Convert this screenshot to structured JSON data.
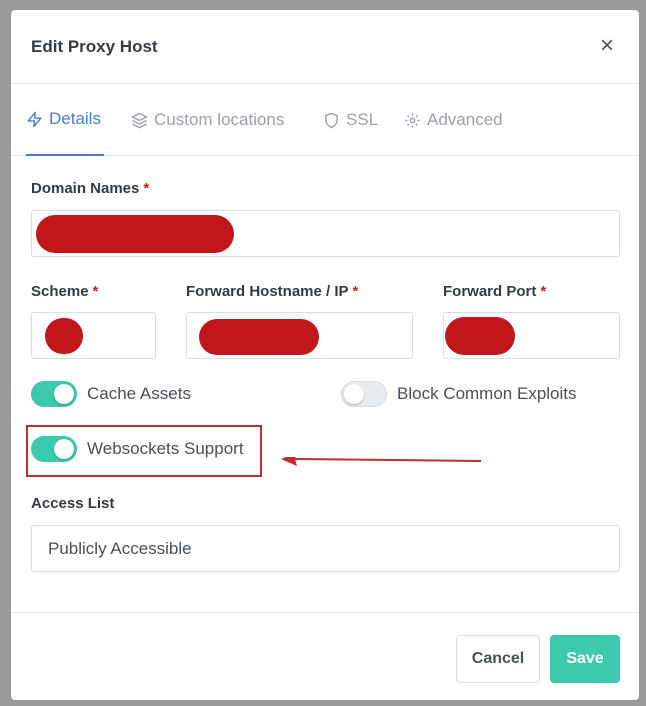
{
  "modal": {
    "title": "Edit Proxy Host",
    "close_symbol": "×"
  },
  "tabs": [
    {
      "label": "Details",
      "icon": "lightning-icon",
      "active": true
    },
    {
      "label": "Custom locations",
      "icon": "layers-icon",
      "active": false
    },
    {
      "label": "SSL",
      "icon": "shield-icon",
      "active": false
    },
    {
      "label": "Advanced",
      "icon": "gear-icon",
      "active": false
    }
  ],
  "form": {
    "domain_names": {
      "label": "Domain Names",
      "required_mark": "*"
    },
    "scheme": {
      "label": "Scheme",
      "required_mark": "*"
    },
    "forward_host": {
      "label": "Forward Hostname / IP",
      "required_mark": "*"
    },
    "forward_port": {
      "label": "Forward Port",
      "required_mark": "*"
    },
    "toggles": {
      "cache_assets": {
        "label": "Cache Assets",
        "enabled": true
      },
      "block_exploits": {
        "label": "Block Common Exploits",
        "enabled": false
      },
      "websockets": {
        "label": "Websockets Support",
        "enabled": true
      }
    },
    "access_list": {
      "label": "Access List",
      "value": "Publicly Accessible"
    }
  },
  "footer": {
    "cancel_label": "Cancel",
    "save_label": "Save"
  },
  "colors": {
    "accent_teal": "#3cc9ae",
    "active_tab_blue": "#467fcf",
    "required_red": "#cd201f",
    "redaction_red": "#c0161c",
    "annotation_red": "#c22c2c"
  }
}
